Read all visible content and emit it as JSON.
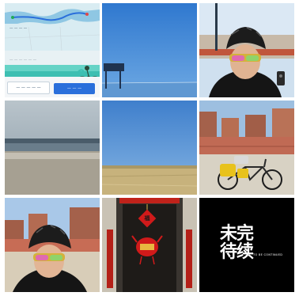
{
  "grid": {
    "tiles": [
      {
        "name": "tile-app-route-screenshot",
        "kind": "app-screenshot"
      },
      {
        "name": "tile-blue-sky-lake",
        "kind": "photo"
      },
      {
        "name": "tile-cyclist-selfie-helmet",
        "kind": "photo"
      },
      {
        "name": "tile-cloudy-lake-horizon",
        "kind": "photo"
      },
      {
        "name": "tile-grassland-blue-sky",
        "kind": "photo"
      },
      {
        "name": "tile-yellow-touring-bicycle",
        "kind": "photo"
      },
      {
        "name": "tile-cyclist-selfie-village",
        "kind": "photo"
      },
      {
        "name": "tile-doorway-fu-decoration",
        "kind": "photo"
      },
      {
        "name": "tile-calligraphy-text",
        "kind": "graphic"
      }
    ]
  },
  "app": {
    "title": "— — — —",
    "label": "— — — —  — —",
    "btn_left": "— — — — —",
    "btn_right": "— — —"
  },
  "doorway": {
    "fu_char": "福"
  },
  "calligraphy": {
    "line1": "未完",
    "line2": "待续",
    "subtitle": "TO BE CONTINUED"
  },
  "colors": {
    "sky_blue": "#3f86d6",
    "lake_blue": "#6aa3df",
    "route_blue": "#2a6fdb",
    "calligraphy_bg": "#000000",
    "calligraphy_fg": "#ffffff",
    "fu_red": "#d01a1a"
  }
}
